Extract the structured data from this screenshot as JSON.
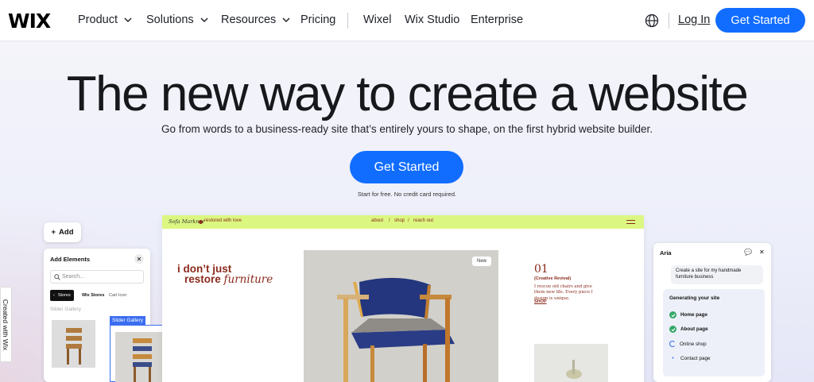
{
  "nav": {
    "logo": "WIX",
    "items": [
      {
        "label": "Product",
        "dropdown": true
      },
      {
        "label": "Solutions",
        "dropdown": true
      },
      {
        "label": "Resources",
        "dropdown": true
      },
      {
        "label": "Pricing",
        "dropdown": false
      },
      {
        "label": "Wixel",
        "dropdown": false
      },
      {
        "label": "Wix Studio",
        "dropdown": false
      },
      {
        "label": "Enterprise",
        "dropdown": false
      }
    ],
    "login": "Log In",
    "cta": "Get Started",
    "icons": {
      "language": "globe-icon"
    }
  },
  "hero": {
    "title": "The new way to create a website",
    "subtitle": "Go from words to a business-ready site that’s entirely yours to shape, on the first hybrid website builder.",
    "cta": "Get Started",
    "note": "Start for free. No credit card required."
  },
  "side_tag": "Created with Wix",
  "editor": {
    "add_button": "Add",
    "add_panel": {
      "title": "Add Elements",
      "search_placeholder": "Search...",
      "tabs": [
        "Stores",
        "Wix Stores",
        "Cart Icon"
      ],
      "section": "Slider Gallery"
    },
    "gallery_label": "Slider Gallery"
  },
  "site_preview": {
    "logo": "Sofa Markner",
    "tagline": "restored with love",
    "links": [
      "about",
      "/",
      "shop",
      "/",
      "reach out"
    ],
    "headline_1": "i don’t just",
    "headline_2a": "restore ",
    "headline_2b": "furniture",
    "badge": "New",
    "number": "01",
    "number_sub": "(Creative Revival)",
    "description": "I rescue old chairs and give them new life. Every piece I design is unique.",
    "shop_link": "SHOP"
  },
  "aria": {
    "title": "Aria",
    "prompt": "Create a site for my handmade furniture business",
    "generating_title": "Generating your site",
    "steps": [
      {
        "label": "Home page",
        "state": "done"
      },
      {
        "label": "About page",
        "state": "done"
      },
      {
        "label": "Online shop",
        "state": "loading"
      },
      {
        "label": "Contact page",
        "state": "pending"
      }
    ]
  },
  "colors": {
    "accent": "#116dff",
    "site_bar": "#dcf781",
    "site_text": "#8a2a1c",
    "success": "#35a869"
  }
}
